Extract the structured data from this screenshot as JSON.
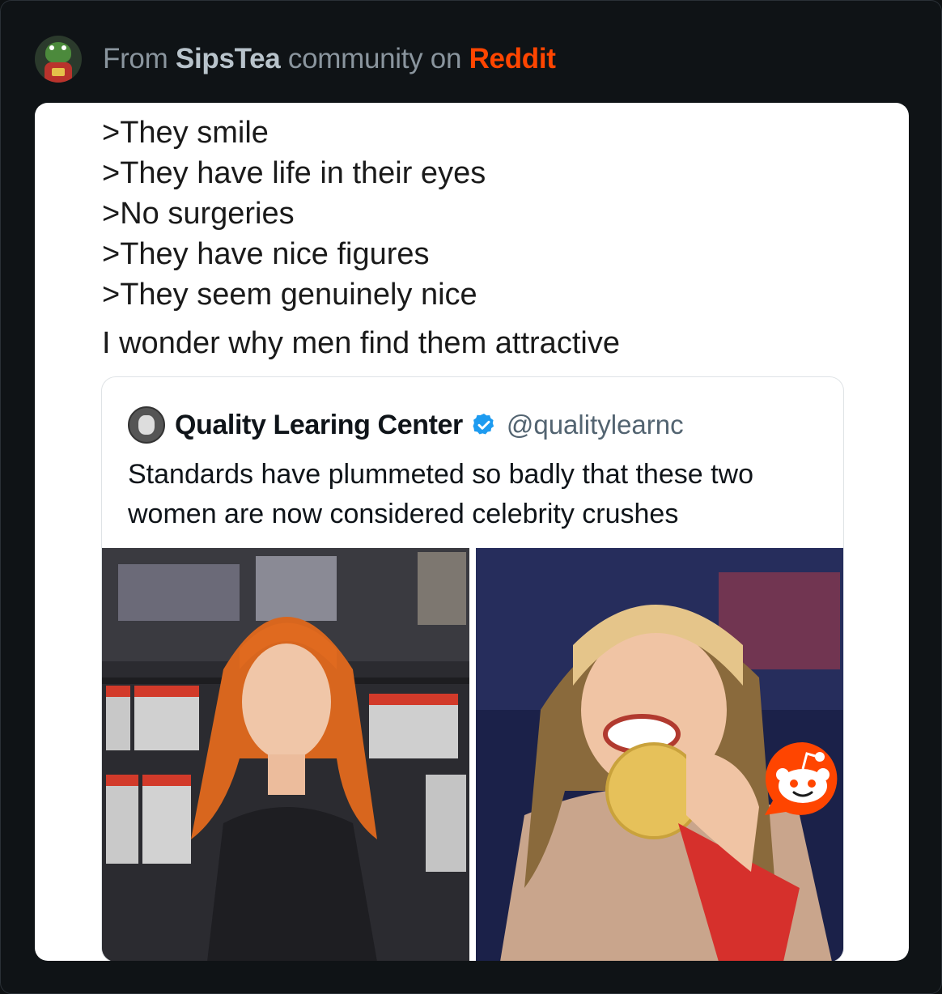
{
  "header": {
    "prefix": "From",
    "community": "SipsTea",
    "middle": "community on",
    "platform": "Reddit"
  },
  "post": {
    "lines": [
      ">They smile",
      ">They have life in their eyes",
      ">No surgeries",
      ">They have nice figures",
      ">They seem genuinely nice"
    ],
    "caption": "I wonder why men find them attractive"
  },
  "tweet": {
    "author": "Quality Learing Center",
    "handle": "@qualitylearnc",
    "verified": true,
    "body": "Standards have plummeted so badly that these two women are now considered celebrity crushes"
  },
  "icons": {
    "avatar": "frog-avatar-icon",
    "verified": "verified-badge-icon",
    "reddit": "reddit-snoo-icon"
  },
  "colors": {
    "background": "#0e1113",
    "reddit_orange": "#ff4500",
    "verified_blue": "#1d9bf0"
  }
}
